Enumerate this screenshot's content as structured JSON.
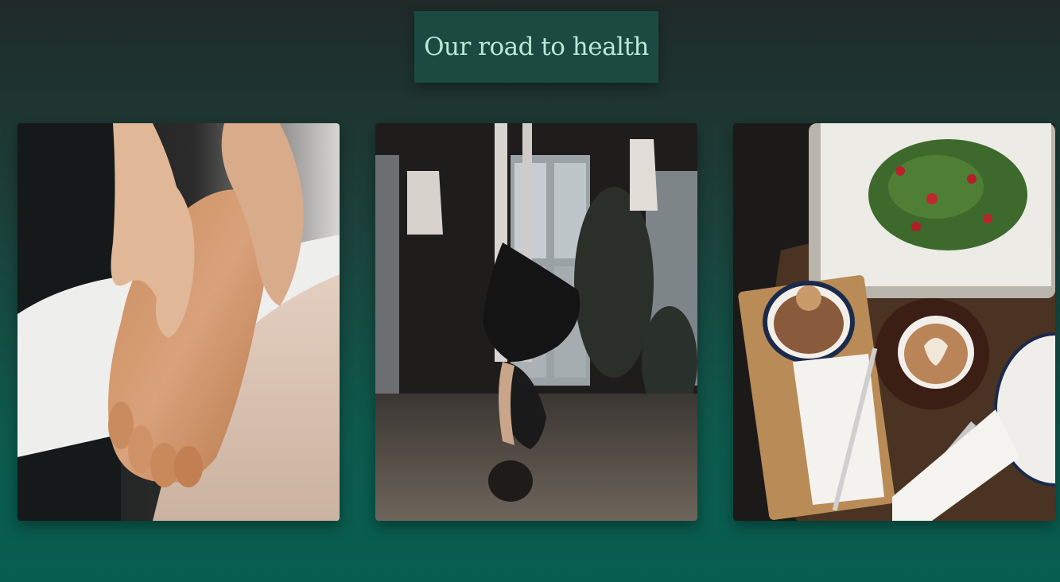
{
  "header": {
    "title": "Our road to health"
  },
  "gallery": {
    "cards": [
      {
        "image": "foot-massage-photo"
      },
      {
        "image": "aerial-yoga-photo"
      },
      {
        "image": "healthy-breakfast-photo"
      }
    ]
  },
  "colors": {
    "title_background": "#1b4a40",
    "title_text": "#b9e8d7",
    "page_top": "#1f2a29",
    "page_bottom": "#075e50"
  }
}
